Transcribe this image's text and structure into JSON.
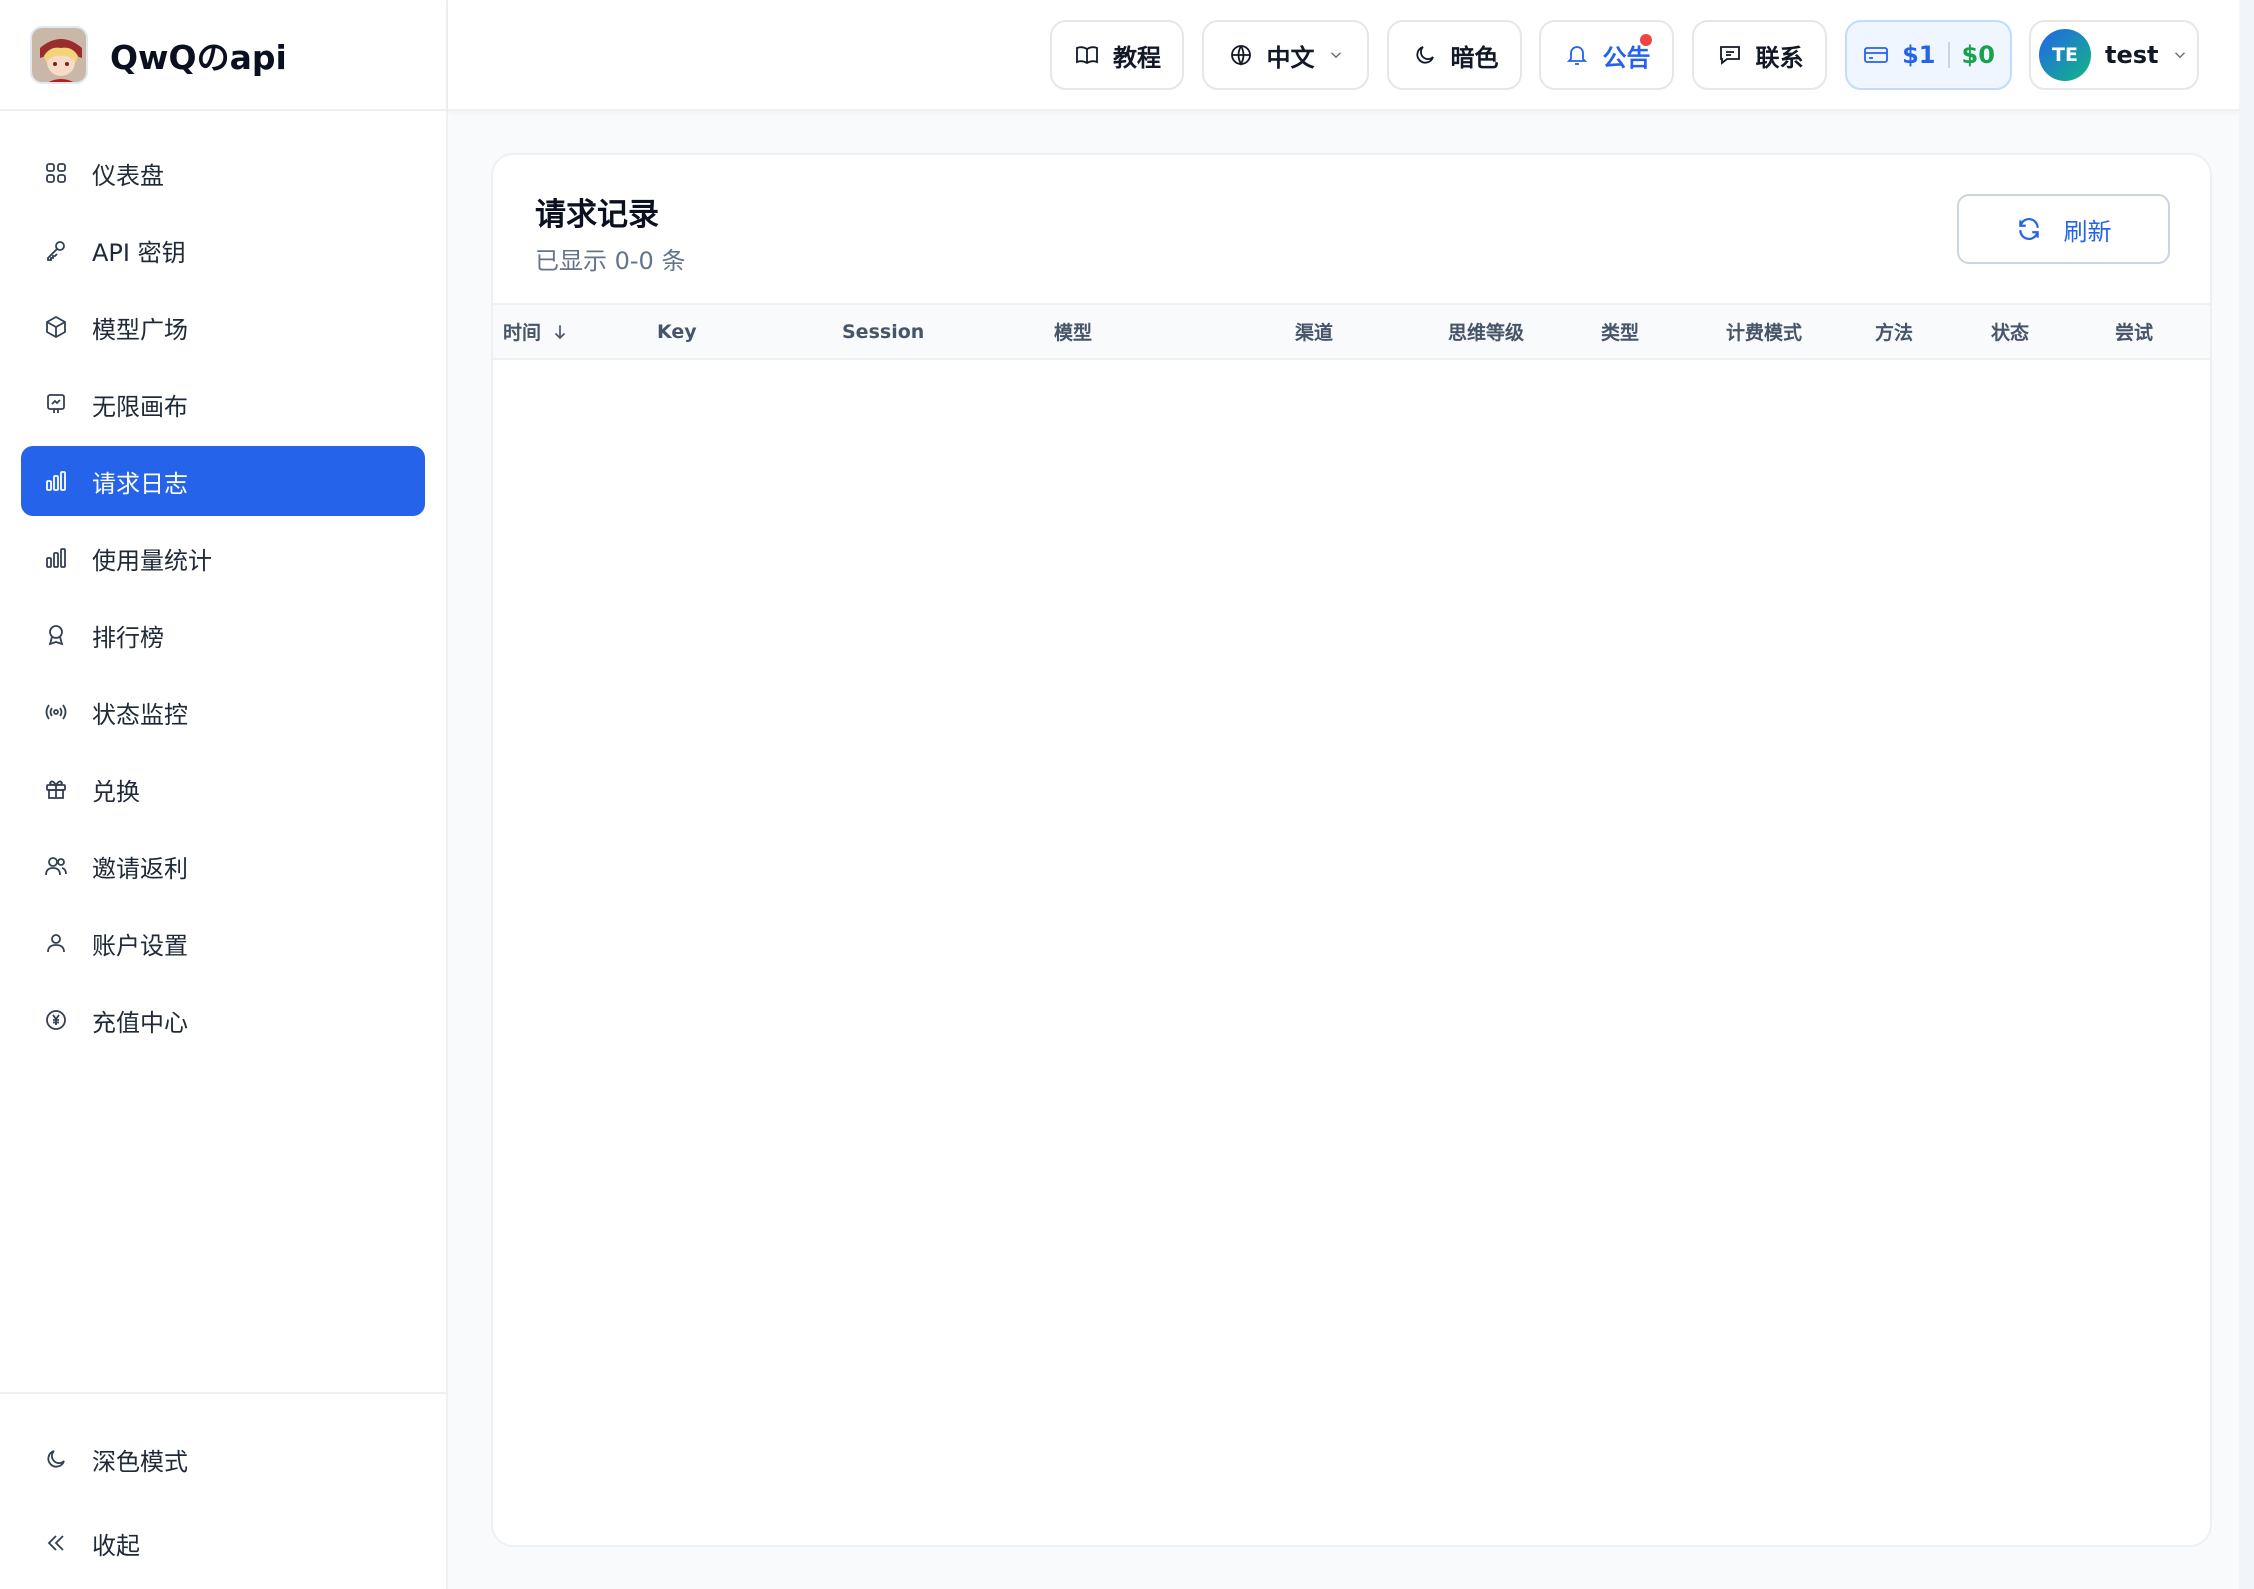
{
  "brand": {
    "name": "QwQのapi"
  },
  "sidebar": {
    "items": [
      {
        "label": "仪表盘",
        "icon": "grid-icon"
      },
      {
        "label": "API 密钥",
        "icon": "key-icon"
      },
      {
        "label": "模型广场",
        "icon": "cube-icon"
      },
      {
        "label": "无限画布",
        "icon": "canvas-icon"
      },
      {
        "label": "请求日志",
        "icon": "bar-chart-icon",
        "active": true
      },
      {
        "label": "使用量统计",
        "icon": "bar-chart-icon"
      },
      {
        "label": "排行榜",
        "icon": "award-icon"
      },
      {
        "label": "状态监控",
        "icon": "radio-signal-icon"
      },
      {
        "label": "兑换",
        "icon": "gift-icon"
      },
      {
        "label": "邀请返利",
        "icon": "users-icon"
      },
      {
        "label": "账户设置",
        "icon": "user-icon"
      },
      {
        "label": "充值中心",
        "icon": "yen-circle-icon"
      }
    ],
    "dark_mode_label": "深色模式",
    "collapse_label": "收起"
  },
  "header": {
    "tutorial_label": "教程",
    "language_label": "中文",
    "theme_label": "暗色",
    "notice_label": "公告",
    "contact_label": "联系",
    "balance_primary": "$1",
    "balance_secondary": "$0",
    "user_initials": "TE",
    "user_name": "test"
  },
  "main": {
    "title": "请求记录",
    "subtitle": "已显示 0-0 条",
    "refresh_label": "刷新",
    "columns": [
      "时间",
      "Key",
      "Session",
      "模型",
      "渠道",
      "思维等级",
      "类型",
      "计费模式",
      "方法",
      "状态",
      "尝试"
    ]
  },
  "colors": {
    "accent": "#2563eb",
    "balance_green": "#16a34a",
    "notice_dot": "#ef4444"
  }
}
